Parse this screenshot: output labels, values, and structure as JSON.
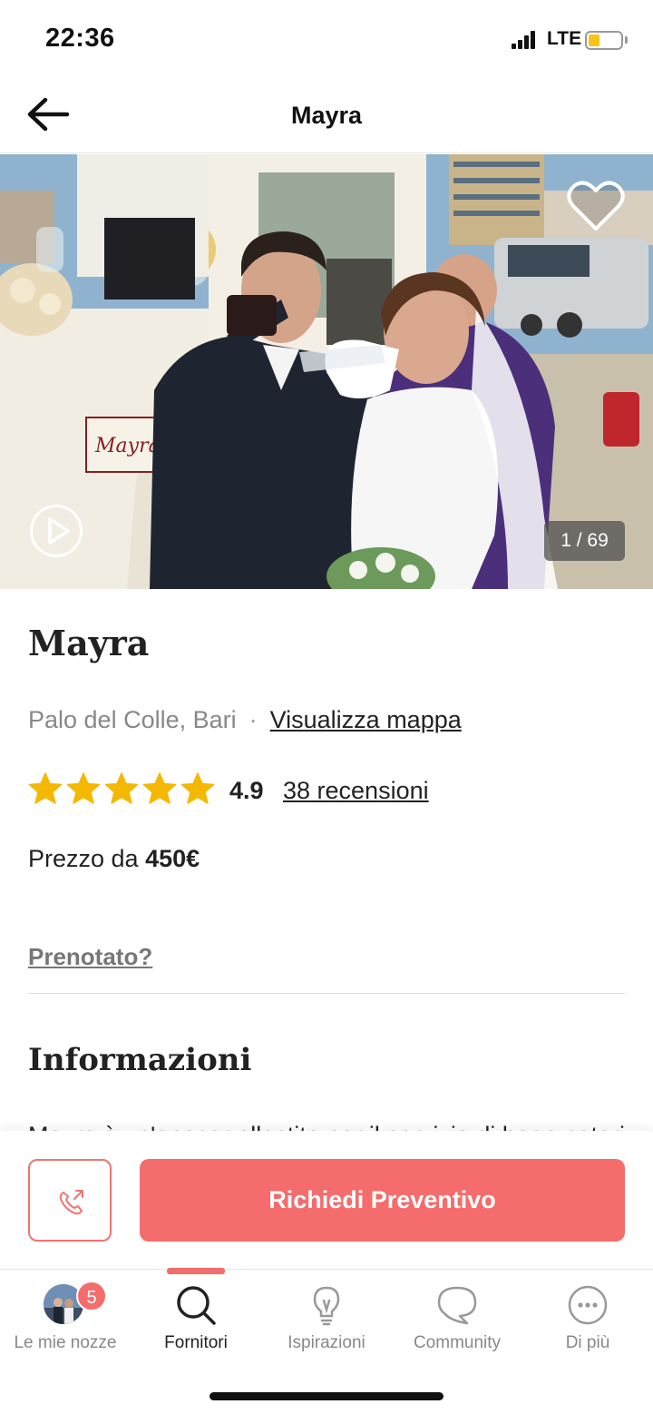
{
  "status_bar": {
    "time": "22:36",
    "network": "LTE",
    "battery_level": 0.35,
    "battery_color": "#f5c518"
  },
  "header": {
    "title": "Mayra",
    "back_icon": "arrow-left-icon"
  },
  "gallery": {
    "counter": "1 / 69",
    "favorite_icon": "heart-outline-icon",
    "play_icon": "play-circle-icon"
  },
  "vendor": {
    "name": "Mayra",
    "location": "Palo del Colle, Bari",
    "separator": "·",
    "map_link": "Visualizza mappa",
    "rating_value": "4.9",
    "stars": 5,
    "reviews_link": "38 recensioni",
    "price_prefix": "Prezzo da",
    "price_value": "450€",
    "booked_link": "Prenotato?"
  },
  "info": {
    "title": "Informazioni",
    "description_peek": "Mayra è un'apecar allestita per il servizio di bar e catering"
  },
  "actions": {
    "call_icon": "phone-call-icon",
    "quote_label": "Richiedi Preventivo"
  },
  "tab_bar": {
    "tabs": [
      {
        "label": "Le mie nozze",
        "icon": "avatar-photo",
        "badge": "5"
      },
      {
        "label": "Fornitori",
        "icon": "search-icon"
      },
      {
        "label": "Ispirazioni",
        "icon": "lightbulb-icon"
      },
      {
        "label": "Community",
        "icon": "chat-bubble-icon"
      },
      {
        "label": "Di più",
        "icon": "more-dots-icon"
      }
    ],
    "active_index": 1
  },
  "colors": {
    "accent": "#f46c6c",
    "star": "#f5b800",
    "text": "#222222",
    "muted": "#888888"
  }
}
